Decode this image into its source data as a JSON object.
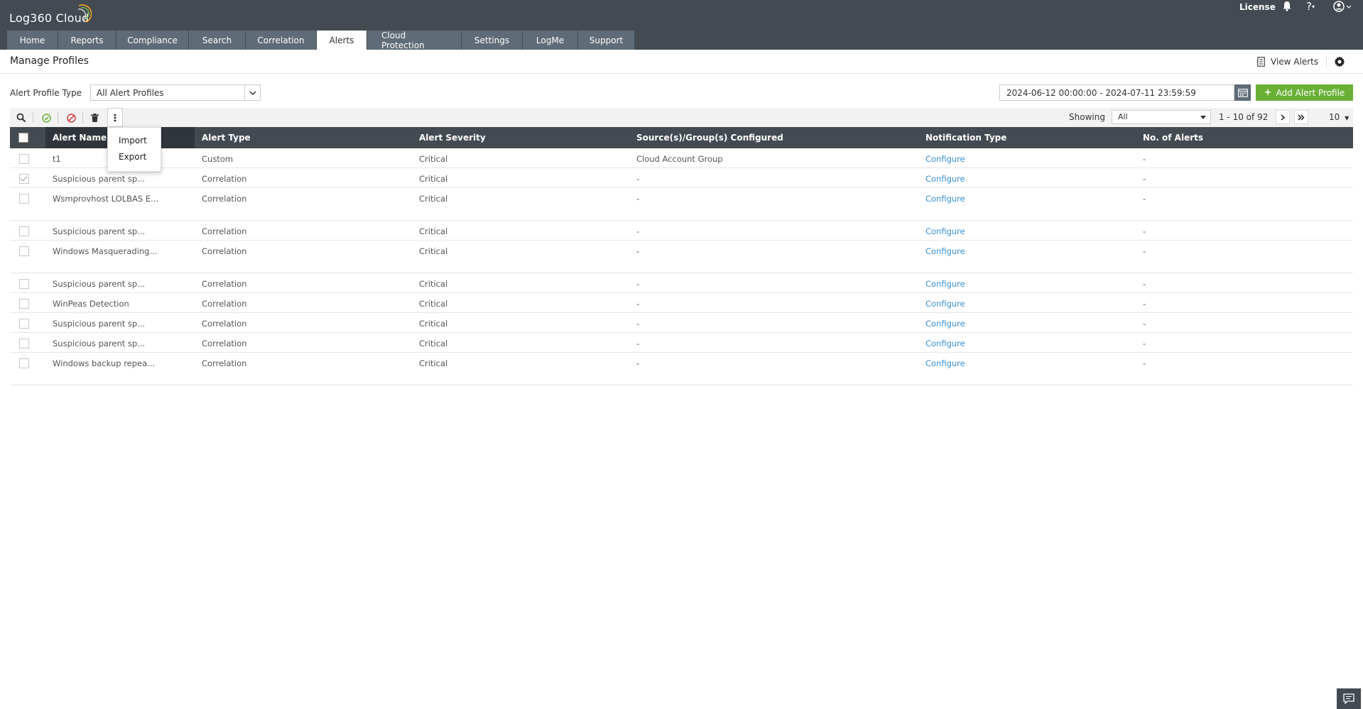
{
  "app": {
    "name": "Log360 Cloud"
  },
  "topbar": {
    "license_label": "License",
    "help_label": "?"
  },
  "tabs": [
    {
      "label": "Home"
    },
    {
      "label": "Reports"
    },
    {
      "label": "Compliance"
    },
    {
      "label": "Search"
    },
    {
      "label": "Correlation"
    },
    {
      "label": "Alerts",
      "active": true
    },
    {
      "label": "Cloud Protection"
    },
    {
      "label": "Settings"
    },
    {
      "label": "LogMe"
    },
    {
      "label": "Support"
    }
  ],
  "header": {
    "title": "Manage Profiles",
    "view_alerts_label": "View Alerts"
  },
  "filter": {
    "label": "Alert Profile Type",
    "selected": "All Alert Profiles"
  },
  "date_range": {
    "value": "2024-06-12 00:00:00 - 2024-07-11 23:59:59"
  },
  "add_button": {
    "label": "Add Alert Profile"
  },
  "toolbar": {
    "showing_label": "Showing",
    "showing_value": "All",
    "page_range": "1 - 10 of 92",
    "per_page": "10"
  },
  "more_menu": {
    "items": [
      "Import",
      "Export"
    ]
  },
  "table": {
    "columns": [
      "Alert Name",
      "Alert Type",
      "Alert Severity",
      "Source(s)/Group(s) Configured",
      "Notification Type",
      "No. of Alerts"
    ],
    "rows": [
      {
        "name": "t1",
        "type": "Custom",
        "severity": "Critical",
        "source": "Cloud Account Group",
        "notification": "Configure",
        "count": "-",
        "checked": false
      },
      {
        "name": "Suspicious parent sp...",
        "type": "Correlation",
        "severity": "Critical",
        "source": "-",
        "notification": "Configure",
        "count": "-",
        "checked": true
      },
      {
        "name": "Wsmprovhost LOLBAS E...",
        "type": "Correlation",
        "severity": "Critical",
        "source": "-",
        "notification": "Configure",
        "count": "-",
        "checked": false
      },
      {
        "name": "Suspicious parent sp...",
        "type": "Correlation",
        "severity": "Critical",
        "source": "-",
        "notification": "Configure",
        "count": "-",
        "checked": false
      },
      {
        "name": "Windows Masquerading...",
        "type": "Correlation",
        "severity": "Critical",
        "source": "-",
        "notification": "Configure",
        "count": "-",
        "checked": false
      },
      {
        "name": "Suspicious parent sp...",
        "type": "Correlation",
        "severity": "Critical",
        "source": "-",
        "notification": "Configure",
        "count": "-",
        "checked": false
      },
      {
        "name": "WinPeas Detection",
        "type": "Correlation",
        "severity": "Critical",
        "source": "-",
        "notification": "Configure",
        "count": "-",
        "checked": false
      },
      {
        "name": "Suspicious parent sp...",
        "type": "Correlation",
        "severity": "Critical",
        "source": "-",
        "notification": "Configure",
        "count": "-",
        "checked": false
      },
      {
        "name": "Suspicious parent sp...",
        "type": "Correlation",
        "severity": "Critical",
        "source": "-",
        "notification": "Configure",
        "count": "-",
        "checked": false
      },
      {
        "name": "Windows backup repea...",
        "type": "Correlation",
        "severity": "Critical",
        "source": "-",
        "notification": "Configure",
        "count": "-",
        "checked": false
      }
    ]
  },
  "colors": {
    "topbar": "#434a51",
    "tab": "#5f6b76",
    "accent_green": "#69b035",
    "link": "#3a8fd2"
  }
}
